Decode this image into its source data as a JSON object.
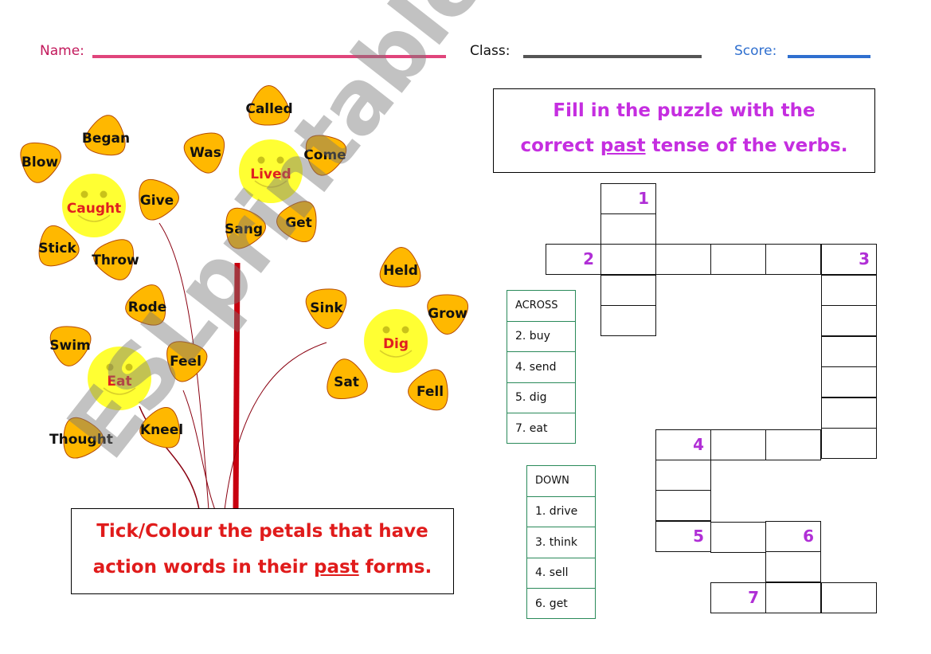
{
  "header": {
    "name_label": "Name:",
    "class_label": "Class:",
    "score_label": "Score:",
    "name_color": "#c2185b",
    "name_line_color": "#e0457b",
    "class_line_color": "#555555",
    "score_color": "#2f6fcf"
  },
  "left_instruction": {
    "line1": "Tick/Colour the petals that have",
    "line2_before": "action words in their ",
    "line2_underlined": "past",
    "line2_after": " forms.",
    "color": "#e01b1b"
  },
  "right_instruction": {
    "line1": "Fill in the puzzle with the",
    "line2_before": "correct ",
    "line2_underlined": "past",
    "line2_after": " tense of the verbs.",
    "color": "#c52ee0"
  },
  "flowers": [
    {
      "center": "Caught",
      "petals": [
        "Began",
        "Give",
        "Throw",
        "Stick",
        "Blow"
      ]
    },
    {
      "center": "Lived",
      "petals": [
        "Called",
        "Come",
        "Get",
        "Sang",
        "Was"
      ]
    },
    {
      "center": "Eat",
      "petals": [
        "Rode",
        "Feel",
        "Kneel",
        "Thought",
        "Swim"
      ]
    },
    {
      "center": "Dig",
      "petals": [
        "Held",
        "Grow",
        "Fell",
        "Sat",
        "Sink"
      ]
    }
  ],
  "colors": {
    "petal_fill": "#ffb800",
    "petal_stroke": "#b54a00",
    "center_fill": "#ffff33",
    "stem": "#c8000f",
    "clue_border": "#2a8a5a",
    "clue_number": "#b02fd6"
  },
  "crossword": {
    "numbers": [
      "1",
      "2",
      "3",
      "4",
      "5",
      "6",
      "7"
    ],
    "across": {
      "heading": "ACROSS",
      "clues": [
        "2. buy",
        "4. send",
        "5. dig",
        "7. eat"
      ]
    },
    "down": {
      "heading": "DOWN",
      "clues": [
        "1. drive",
        "3. think",
        "4. sell",
        "6. get"
      ]
    }
  },
  "watermark": "ESLprintables.com"
}
